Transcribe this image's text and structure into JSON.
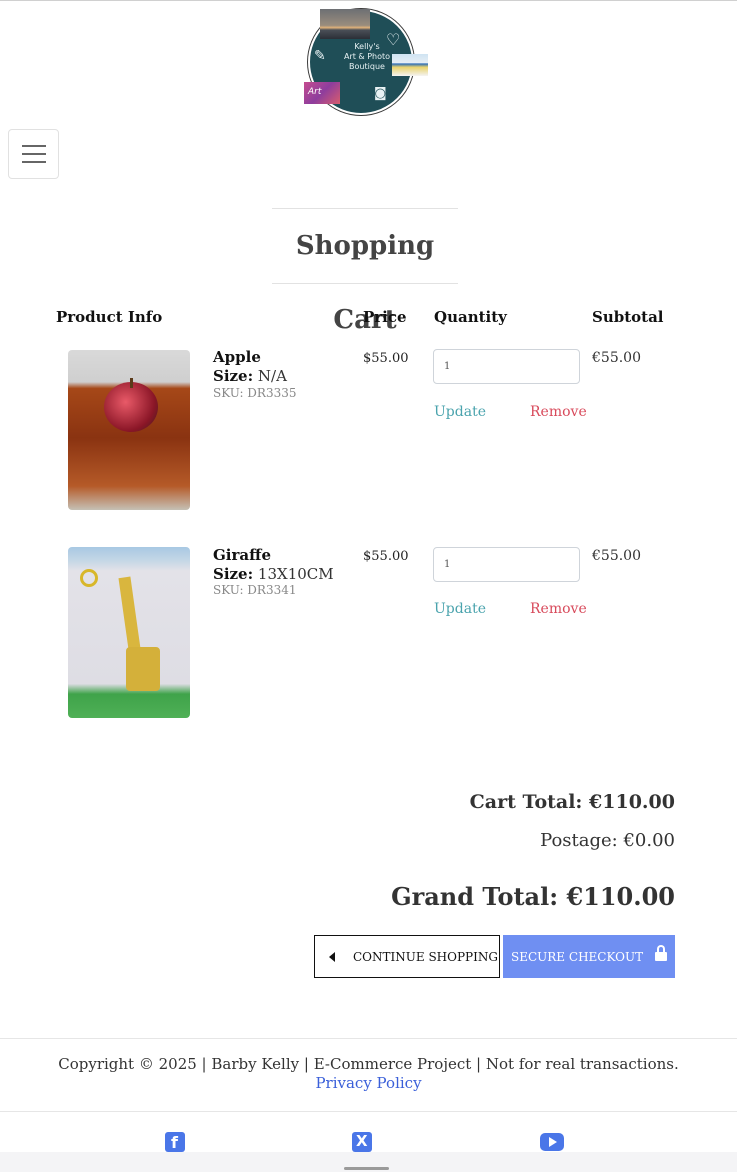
{
  "logo": {
    "text_line1": "Kelly's",
    "text_line2": "Art & Photo",
    "text_line3": "Boutique",
    "badge_text": "Art"
  },
  "page": {
    "title": "Shopping Cart"
  },
  "table": {
    "headers": [
      "Product Info",
      "Price",
      "Quantity",
      "Subtotal"
    ]
  },
  "items": [
    {
      "name": "Apple",
      "size_label": "Size:",
      "size": "N/A",
      "sku": "SKU: DR3335",
      "price": "$55.00",
      "quantity": "1",
      "update_label": "Update",
      "remove_label": "Remove",
      "subtotal": "€55.00"
    },
    {
      "name": "Giraffe",
      "size_label": "Size:",
      "size": "13X10CM",
      "sku": "SKU: DR3341",
      "price": "$55.00",
      "quantity": "1",
      "update_label": "Update",
      "remove_label": "Remove",
      "subtotal": "€55.00"
    }
  ],
  "totals": {
    "cart_total": "Cart Total: €110.00",
    "postage": "Postage: €0.00",
    "grand_total": "Grand Total: €110.00"
  },
  "buttons": {
    "continue": "CONTINUE SHOPPING",
    "checkout": "SECURE CHECKOUT"
  },
  "footer": {
    "copyright": "Copyright © 2025 | Barby Kelly | E-Commerce Project | Not for real transactions.",
    "privacy": "Privacy Policy"
  },
  "social": [
    "facebook-icon",
    "x-twitter-icon",
    "youtube-icon"
  ],
  "colors": {
    "accent": "#6f8ff2",
    "update": "#4aa3ad",
    "remove": "#d84a5b",
    "link": "#3a5fd9"
  }
}
